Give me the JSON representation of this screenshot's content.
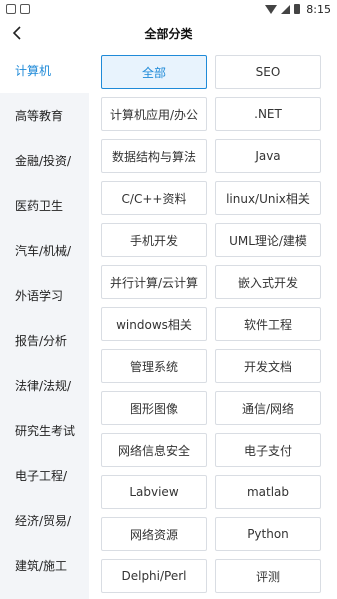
{
  "status_bar": {
    "time": "8:15"
  },
  "header": {
    "title": "全部分类"
  },
  "sidebar": {
    "items": [
      {
        "label": "计算机",
        "active": true
      },
      {
        "label": "高等教育"
      },
      {
        "label": "金融/投资/"
      },
      {
        "label": "医药卫生"
      },
      {
        "label": "汽车/机械/"
      },
      {
        "label": "外语学习"
      },
      {
        "label": "报告/分析"
      },
      {
        "label": "法律/法规/"
      },
      {
        "label": "研究生考试"
      },
      {
        "label": "电子工程/"
      },
      {
        "label": "经济/贸易/"
      },
      {
        "label": "建筑/施工"
      }
    ]
  },
  "categories": {
    "items": [
      {
        "label": "全部",
        "active": true
      },
      {
        "label": "SEO"
      },
      {
        "label": "计算机应用/办公"
      },
      {
        "label": ".NET"
      },
      {
        "label": "数据结构与算法"
      },
      {
        "label": "Java"
      },
      {
        "label": "C/C++资料"
      },
      {
        "label": "linux/Unix相关"
      },
      {
        "label": "手机开发"
      },
      {
        "label": "UML理论/建模"
      },
      {
        "label": "并行计算/云计算"
      },
      {
        "label": "嵌入式开发"
      },
      {
        "label": "windows相关"
      },
      {
        "label": "软件工程"
      },
      {
        "label": "管理系统"
      },
      {
        "label": "开发文档"
      },
      {
        "label": "图形图像"
      },
      {
        "label": "通信/网络"
      },
      {
        "label": "网络信息安全"
      },
      {
        "label": "电子支付"
      },
      {
        "label": "Labview"
      },
      {
        "label": "matlab"
      },
      {
        "label": "网络资源"
      },
      {
        "label": "Python"
      },
      {
        "label": "Delphi/Perl"
      },
      {
        "label": "评测"
      }
    ]
  },
  "colors": {
    "accent": "#1f8ad8",
    "sidebar_bg": "#f3f5f8"
  }
}
